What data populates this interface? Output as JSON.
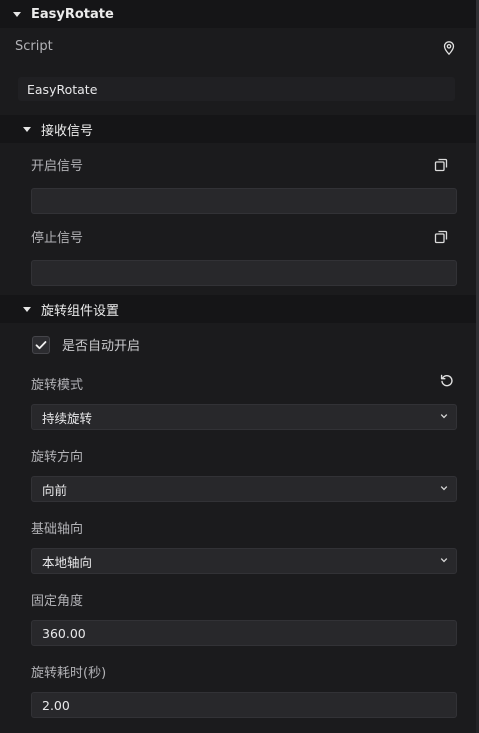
{
  "component": {
    "title": "EasyRotate",
    "script_label": "Script",
    "script_value": "EasyRotate",
    "script_icon": "location-pin-icon"
  },
  "signal_section": {
    "title": "接收信号",
    "start_signal_label": "开启信号",
    "start_signal_value": "",
    "stop_signal_label": "停止信号",
    "stop_signal_value": "",
    "copy_icon": "copy-icon"
  },
  "rotate_section": {
    "title": "旋转组件设置",
    "auto_start_label": "是否自动开启",
    "auto_start_checked": true,
    "mode_label": "旋转模式",
    "mode_value": "持续旋转",
    "reset_icon": "reset-icon",
    "direction_label": "旋转方向",
    "direction_value": "向前",
    "axis_label": "基础轴向",
    "axis_value": "本地轴向",
    "angle_label": "固定角度",
    "angle_value": "360.00",
    "duration_label": "旋转耗时(秒)",
    "duration_value": "2.00"
  },
  "colors": {
    "background": "#1b1b1d",
    "header": "#151517",
    "field": "#28282b",
    "text": "#c9c9cc"
  }
}
